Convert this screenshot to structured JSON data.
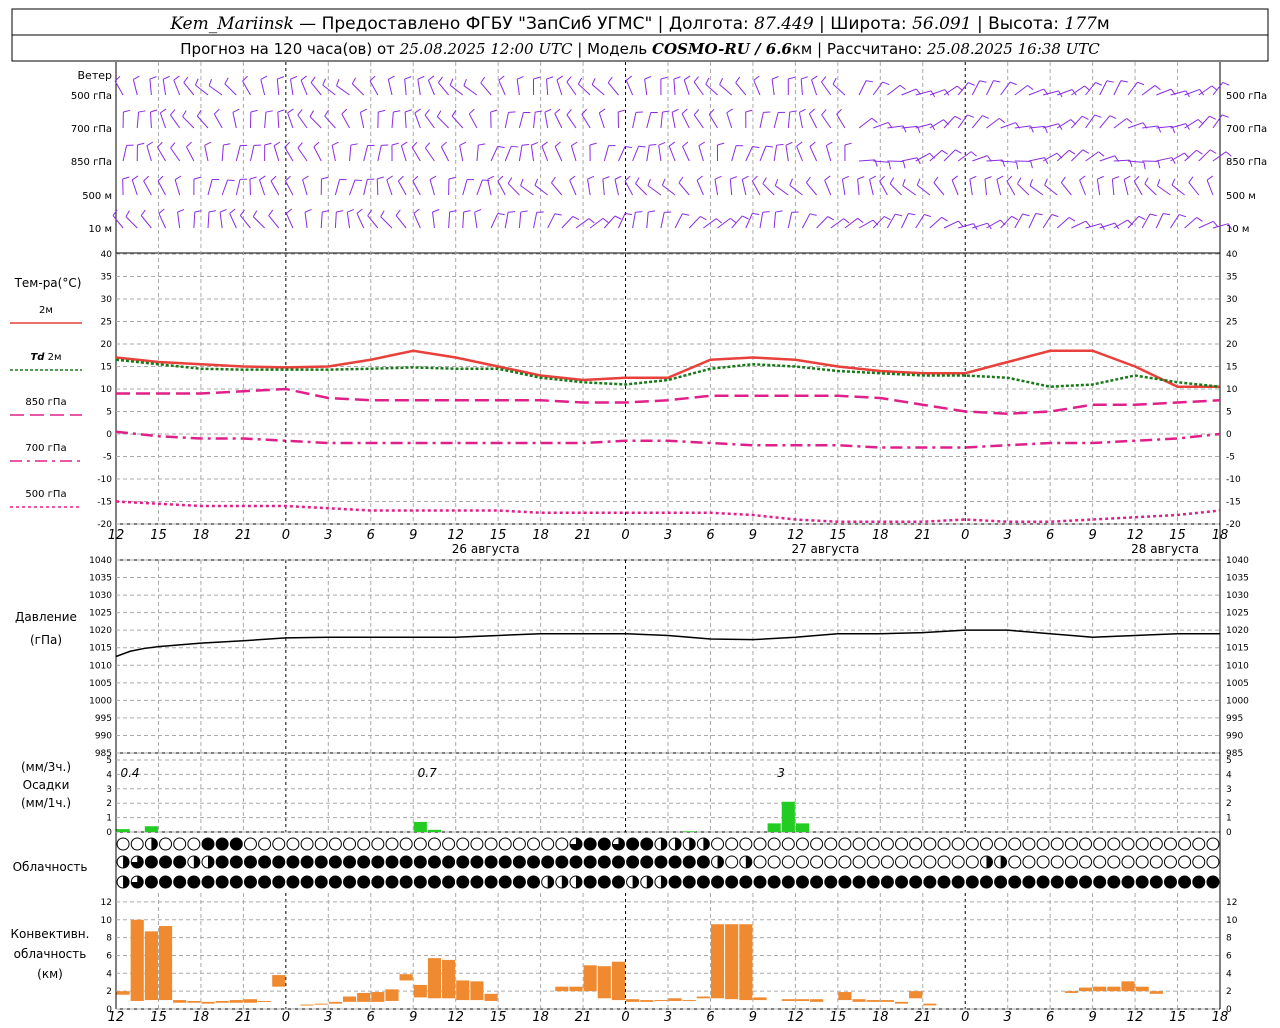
{
  "header": {
    "station": "Kem_Mariinsk",
    "dash": " — ",
    "provider": "Предоставлено ФГБУ \"ЗапСиб УГМС\"",
    "lon_label": "Долгота:",
    "lon_value": "87.449",
    "lat_label": "Широта:",
    "lat_value": "56.091",
    "alt_label": "Высота:",
    "alt_value": "177",
    "alt_unit": "м",
    "forecast_prefix": "Прогноз на 120 часа(ов) от",
    "forecast_start": "25.08.2025 12:00 UTC",
    "model_label": "Модель",
    "model_name": "COSMO-RU / 6.6",
    "model_unit": "км",
    "computed_label": "Рассчитано:",
    "computed_value": "25.08.2025 16:38 UTC"
  },
  "colors": {
    "wind": "#8a2be2",
    "t2m": "#e8403a",
    "td2m": "#1a7a1a",
    "t850": "#e0208a",
    "t700": "#e0208a",
    "t500": "#e0208a",
    "pressure": "#000000",
    "precip": "#22cc22",
    "convective": "#f08a30",
    "grid": "#aaaaaa"
  },
  "time_axis": {
    "ticks": [
      "12",
      "15",
      "18",
      "21",
      "0",
      "3",
      "6",
      "9",
      "12",
      "15",
      "18",
      "21",
      "0",
      "3",
      "6",
      "9",
      "12",
      "15",
      "18",
      "21",
      "0",
      "3",
      "6",
      "9",
      "12",
      "15",
      "18"
    ],
    "dates": [
      {
        "label": "26 августа",
        "at_index": 8
      },
      {
        "label": "27 августа",
        "at_index": 16
      },
      {
        "label": "28 августа",
        "at_index": 24
      }
    ],
    "midnight_indices": [
      4,
      12,
      20
    ]
  },
  "wind_panel": {
    "title": "Ветер",
    "levels": [
      "500 гПа",
      "700 гПа",
      "850 гПа",
      "500 м",
      "10 м"
    ],
    "icon": "wind-barb-icon"
  },
  "chart_data": [
    {
      "type": "line",
      "id": "temperature",
      "title": "Тем-ра(°C)",
      "ylim": [
        -20,
        40
      ],
      "yticks": [
        -20,
        -15,
        -10,
        -5,
        0,
        5,
        10,
        15,
        20,
        25,
        30,
        35,
        40
      ],
      "x_hours": [
        0,
        3,
        6,
        9,
        12,
        15,
        18,
        21,
        24,
        27,
        30,
        33,
        36,
        39,
        42,
        45,
        48,
        51,
        54,
        57,
        60,
        63,
        66,
        69,
        72,
        75,
        78
      ],
      "series": [
        {
          "name": "2м",
          "style": "solid",
          "values": [
            17,
            16,
            15.5,
            15,
            14.8,
            15,
            16.5,
            18.5,
            17,
            15,
            13,
            12,
            12.5,
            12.5,
            16.5,
            17,
            16.5,
            15,
            14,
            13.5,
            13.5,
            16,
            18.5,
            18.5,
            15,
            10.5,
            10.5
          ]
        },
        {
          "name": "Td 2м",
          "style": "dotted",
          "values": [
            16.5,
            15.5,
            14.5,
            14.3,
            14.3,
            14.3,
            14.5,
            14.8,
            14.5,
            14.5,
            12.5,
            11.5,
            11,
            12,
            14.5,
            15.5,
            15,
            14,
            13.5,
            13,
            13,
            12.5,
            10.5,
            11,
            13,
            11.5,
            10.5
          ]
        },
        {
          "name": "850 гПа",
          "style": "dash",
          "values": [
            9,
            9,
            9,
            9.5,
            10,
            8,
            7.5,
            7.5,
            7.5,
            7.5,
            7.5,
            7,
            7,
            7.5,
            8.5,
            8.5,
            8.5,
            8.5,
            8,
            6.5,
            5,
            4.5,
            5,
            6.5,
            6.5,
            7,
            7.5
          ]
        },
        {
          "name": "700 гПа",
          "style": "dashdot",
          "values": [
            0.5,
            -0.5,
            -1,
            -1,
            -1.5,
            -2,
            -2,
            -2,
            -2,
            -2,
            -2,
            -2,
            -1.5,
            -1.5,
            -2,
            -2.5,
            -2.5,
            -2.5,
            -3,
            -3,
            -3,
            -2.5,
            -2,
            -2,
            -1.5,
            -1,
            0
          ]
        },
        {
          "name": "500 гПа",
          "style": "dot",
          "values": [
            -15,
            -15.5,
            -16,
            -16,
            -16,
            -16.5,
            -17,
            -17,
            -17,
            -17,
            -17.5,
            -17.5,
            -17.5,
            -17.5,
            -17.5,
            -18,
            -19,
            -19.5,
            -19.5,
            -19.5,
            -19,
            -19.5,
            -19.5,
            -19,
            -18.5,
            -18,
            -17
          ]
        }
      ]
    },
    {
      "type": "line",
      "id": "pressure",
      "title": "Давление",
      "ylabel": "(гПа)",
      "ylim": [
        985,
        1040
      ],
      "yticks": [
        985,
        990,
        995,
        1000,
        1005,
        1010,
        1015,
        1020,
        1025,
        1030,
        1035,
        1040
      ],
      "x_hours": [
        0,
        1,
        2,
        3,
        6,
        9,
        12,
        15,
        18,
        21,
        24,
        27,
        30,
        33,
        36,
        39,
        42,
        45,
        48,
        51,
        54,
        57,
        60,
        63,
        66,
        69,
        72,
        75,
        78
      ],
      "values": [
        1012.5,
        1014,
        1014.8,
        1015.3,
        1016.3,
        1017,
        1017.8,
        1018,
        1018,
        1018,
        1018,
        1018.5,
        1019,
        1019,
        1019,
        1018.5,
        1017.5,
        1017.3,
        1018,
        1019,
        1019,
        1019.3,
        1020,
        1020,
        1019,
        1018,
        1018.5,
        1019,
        1019
      ]
    },
    {
      "type": "bar",
      "id": "precipitation",
      "ylabel_top": "(мм/3ч.)",
      "title": "Осадки",
      "ylabel_bottom": "(мм/1ч.)",
      "ylim": [
        0,
        5
      ],
      "yticks": [
        0,
        1,
        2,
        3,
        4,
        5
      ],
      "totals": [
        {
          "label": "0.4",
          "at_hour": 0
        },
        {
          "label": "0.7",
          "at_hour": 21
        },
        {
          "label": "3",
          "at_hour": 46
        }
      ],
      "bars": [
        {
          "hour": 0,
          "value": 0.2
        },
        {
          "hour": 2,
          "value": 0.4
        },
        {
          "hour": 21,
          "value": 0.7
        },
        {
          "hour": 22,
          "value": 0.15
        },
        {
          "hour": 40,
          "value": 0.05
        },
        {
          "hour": 46,
          "value": 0.6
        },
        {
          "hour": 47,
          "value": 2.1
        },
        {
          "hour": 48,
          "value": 0.6
        }
      ]
    },
    {
      "type": "bar",
      "id": "convective_cloud",
      "title": "Конвективн.",
      "ylabel_mid": "облачность",
      "ylabel_bottom": "(км)",
      "ylim": [
        0,
        13
      ],
      "yticks": [
        0,
        2,
        4,
        6,
        8,
        10,
        12
      ],
      "bars": [
        {
          "hour": 0,
          "base": 1.6,
          "top": 2.0
        },
        {
          "hour": 1,
          "base": 0.9,
          "top": 10.0
        },
        {
          "hour": 2,
          "base": 1.0,
          "top": 8.7
        },
        {
          "hour": 3,
          "base": 1.0,
          "top": 9.3
        },
        {
          "hour": 4,
          "base": 0.7,
          "top": 1.0
        },
        {
          "hour": 5,
          "base": 0.7,
          "top": 0.9
        },
        {
          "hour": 6,
          "base": 0.6,
          "top": 0.8
        },
        {
          "hour": 7,
          "base": 0.7,
          "top": 0.9
        },
        {
          "hour": 8,
          "base": 0.7,
          "top": 1.0
        },
        {
          "hour": 9,
          "base": 0.7,
          "top": 1.1
        },
        {
          "hour": 10,
          "base": 0.8,
          "top": 0.9
        },
        {
          "hour": 11,
          "base": 2.5,
          "top": 3.8
        },
        {
          "hour": 13,
          "base": 0.4,
          "top": 0.5
        },
        {
          "hour": 14,
          "base": 0.5,
          "top": 0.6
        },
        {
          "hour": 15,
          "base": 0.6,
          "top": 0.8
        },
        {
          "hour": 16,
          "base": 0.8,
          "top": 1.4
        },
        {
          "hour": 17,
          "base": 0.8,
          "top": 1.8
        },
        {
          "hour": 18,
          "base": 0.8,
          "top": 1.9
        },
        {
          "hour": 19,
          "base": 0.9,
          "top": 2.2
        },
        {
          "hour": 20,
          "base": 3.2,
          "top": 3.9
        },
        {
          "hour": 21,
          "base": 1.3,
          "top": 2.7
        },
        {
          "hour": 22,
          "base": 1.2,
          "top": 5.7
        },
        {
          "hour": 23,
          "base": 1.2,
          "top": 5.5
        },
        {
          "hour": 24,
          "base": 1.0,
          "top": 3.2
        },
        {
          "hour": 25,
          "base": 1.0,
          "top": 3.1
        },
        {
          "hour": 26,
          "base": 0.9,
          "top": 1.7
        },
        {
          "hour": 31,
          "base": 2.0,
          "top": 2.5
        },
        {
          "hour": 32,
          "base": 2.0,
          "top": 2.5
        },
        {
          "hour": 33,
          "base": 2.0,
          "top": 4.9
        },
        {
          "hour": 34,
          "base": 1.2,
          "top": 4.8
        },
        {
          "hour": 35,
          "base": 1.0,
          "top": 5.3
        },
        {
          "hour": 36,
          "base": 0.8,
          "top": 1.1
        },
        {
          "hour": 37,
          "base": 0.8,
          "top": 1.0
        },
        {
          "hour": 38,
          "base": 0.9,
          "top": 1.0
        },
        {
          "hour": 39,
          "base": 0.9,
          "top": 1.2
        },
        {
          "hour": 40,
          "base": 0.9,
          "top": 1.0
        },
        {
          "hour": 41,
          "base": 1.2,
          "top": 1.4
        },
        {
          "hour": 42,
          "base": 1.2,
          "top": 9.5
        },
        {
          "hour": 43,
          "base": 1.1,
          "top": 9.5
        },
        {
          "hour": 44,
          "base": 1.0,
          "top": 9.5
        },
        {
          "hour": 45,
          "base": 1.0,
          "top": 1.3
        },
        {
          "hour": 47,
          "base": 0.9,
          "top": 1.1
        },
        {
          "hour": 48,
          "base": 0.9,
          "top": 1.1
        },
        {
          "hour": 49,
          "base": 0.8,
          "top": 1.1
        },
        {
          "hour": 51,
          "base": 1.0,
          "top": 1.9
        },
        {
          "hour": 52,
          "base": 0.8,
          "top": 1.1
        },
        {
          "hour": 53,
          "base": 0.8,
          "top": 1.0
        },
        {
          "hour": 54,
          "base": 0.8,
          "top": 1.0
        },
        {
          "hour": 55,
          "base": 0.6,
          "top": 0.8
        },
        {
          "hour": 56,
          "base": 1.2,
          "top": 2.0
        },
        {
          "hour": 57,
          "base": 0.4,
          "top": 0.6
        },
        {
          "hour": 67,
          "base": 1.8,
          "top": 2.0
        },
        {
          "hour": 68,
          "base": 2.0,
          "top": 2.4
        },
        {
          "hour": 69,
          "base": 2.0,
          "top": 2.5
        },
        {
          "hour": 70,
          "base": 2.0,
          "top": 2.5
        },
        {
          "hour": 71,
          "base": 2.0,
          "top": 3.1
        },
        {
          "hour": 72,
          "base": 2.0,
          "top": 2.5
        },
        {
          "hour": 73,
          "base": 1.7,
          "top": 2.0
        }
      ]
    }
  ],
  "cloud_panel": {
    "title": "Облачность",
    "rows": [
      "0010002220000000000000000000000032232211110000000000000000000000000000000000000000000000000000000000000000000000000000",
      "1322211222222222222222222222222222222222221010000000000000000110000000000000000000000000000000000000000000000000000000",
      "1322222222222222222222222222221112221112222222222222222222222222222222222222222222222222222211100001010000000000000000"
    ]
  }
}
